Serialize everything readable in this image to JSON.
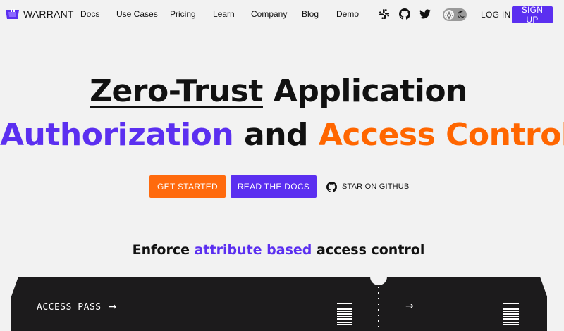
{
  "brand": {
    "name": "WARRANT"
  },
  "nav": {
    "links": [
      "Docs",
      "Use Cases",
      "Pricing",
      "Learn",
      "Company",
      "Blog",
      "Demo"
    ],
    "login_label": "LOG IN",
    "signup_label": "SIGN UP",
    "social_icons": [
      "slack-icon",
      "github-icon",
      "twitter-icon"
    ],
    "theme_icons": [
      "sun-icon",
      "moon-icon"
    ]
  },
  "hero": {
    "line1_underlined": "Zero-Trust",
    "line1_rest": " Application",
    "line2_purple": "Authorization",
    "line2_mid": " and ",
    "line2_orange": "Access Control"
  },
  "cta": {
    "get_started": "GET STARTED",
    "read_docs": "READ THE DOCS",
    "star_github": "STAR ON GITHUB"
  },
  "enforce": {
    "pre": "Enforce ",
    "highlight": "attribute based",
    "post": " access control"
  },
  "ticket": {
    "title": "ACCESS PASS",
    "arrow": "→"
  },
  "colors": {
    "purple": "#5b2ff0",
    "orange": "#ff6a0d",
    "background": "#f2f2f2",
    "ticket": "#1c1b1c"
  }
}
